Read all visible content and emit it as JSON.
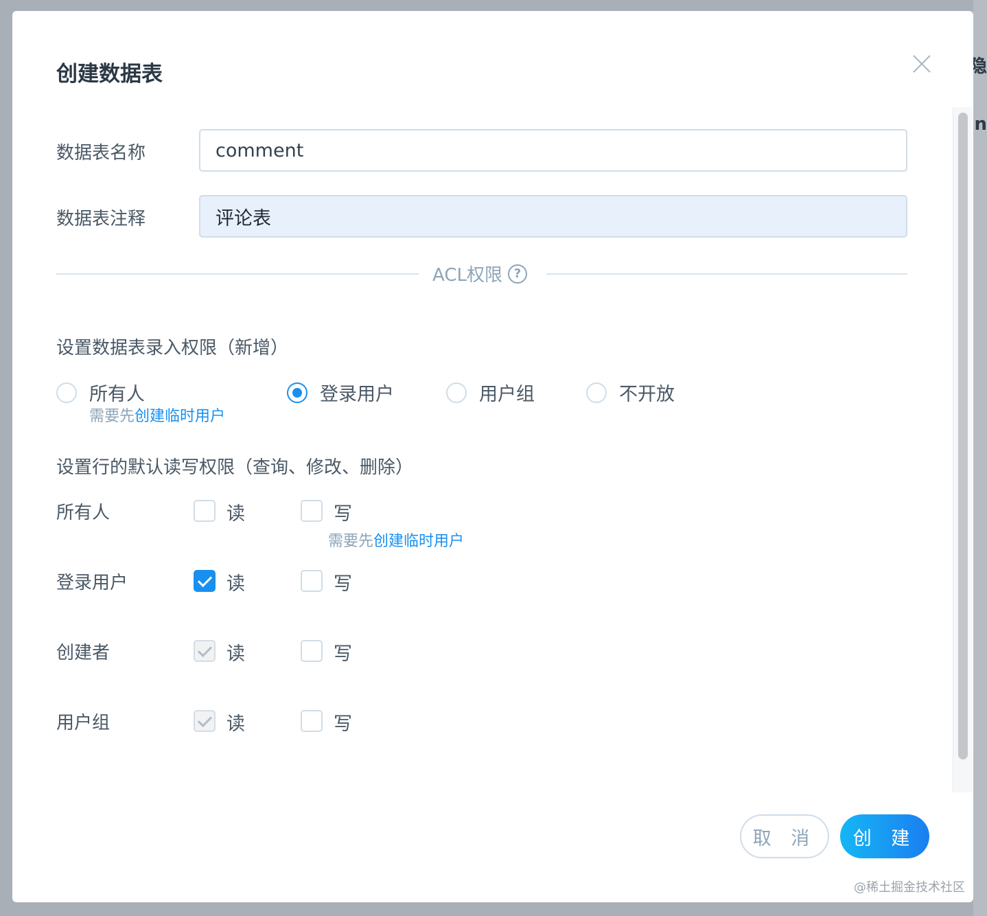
{
  "backdrop": {
    "text1": "隐",
    "text2": "in"
  },
  "dialog": {
    "title": "创建数据表"
  },
  "fields": {
    "name_label": "数据表名称",
    "name_value": "comment",
    "comment_label": "数据表注释",
    "comment_value": "评论表"
  },
  "acl": {
    "divider_text": "ACL权限",
    "help_glyph": "?"
  },
  "insert_permission": {
    "title": "设置数据表录入权限（新增）",
    "options": [
      {
        "label": "所有人",
        "checked": false
      },
      {
        "label": "登录用户",
        "checked": true
      },
      {
        "label": "用户组",
        "checked": false
      },
      {
        "label": "不开放",
        "checked": false
      }
    ],
    "hint_prefix": "需要先",
    "hint_link": "创建临时用户"
  },
  "row_permission": {
    "title": "设置行的默认读写权限（查询、修改、删除）",
    "read_label": "读",
    "write_label": "写",
    "hint_prefix": "需要先",
    "hint_link": "创建临时用户",
    "rows": [
      {
        "role": "所有人",
        "read": "unchecked",
        "write": "unchecked"
      },
      {
        "role": "登录用户",
        "read": "checked",
        "write": "unchecked"
      },
      {
        "role": "创建者",
        "read": "checked-disabled",
        "write": "unchecked"
      },
      {
        "role": "用户组",
        "read": "checked-disabled",
        "write": "unchecked"
      }
    ]
  },
  "footer": {
    "cancel_label": "取 消",
    "create_label": "创 建"
  },
  "watermark": "@稀土掘金技术社区",
  "colors": {
    "primary": "#1890f0",
    "muted": "#8da5b8",
    "text": "#4a5866"
  }
}
